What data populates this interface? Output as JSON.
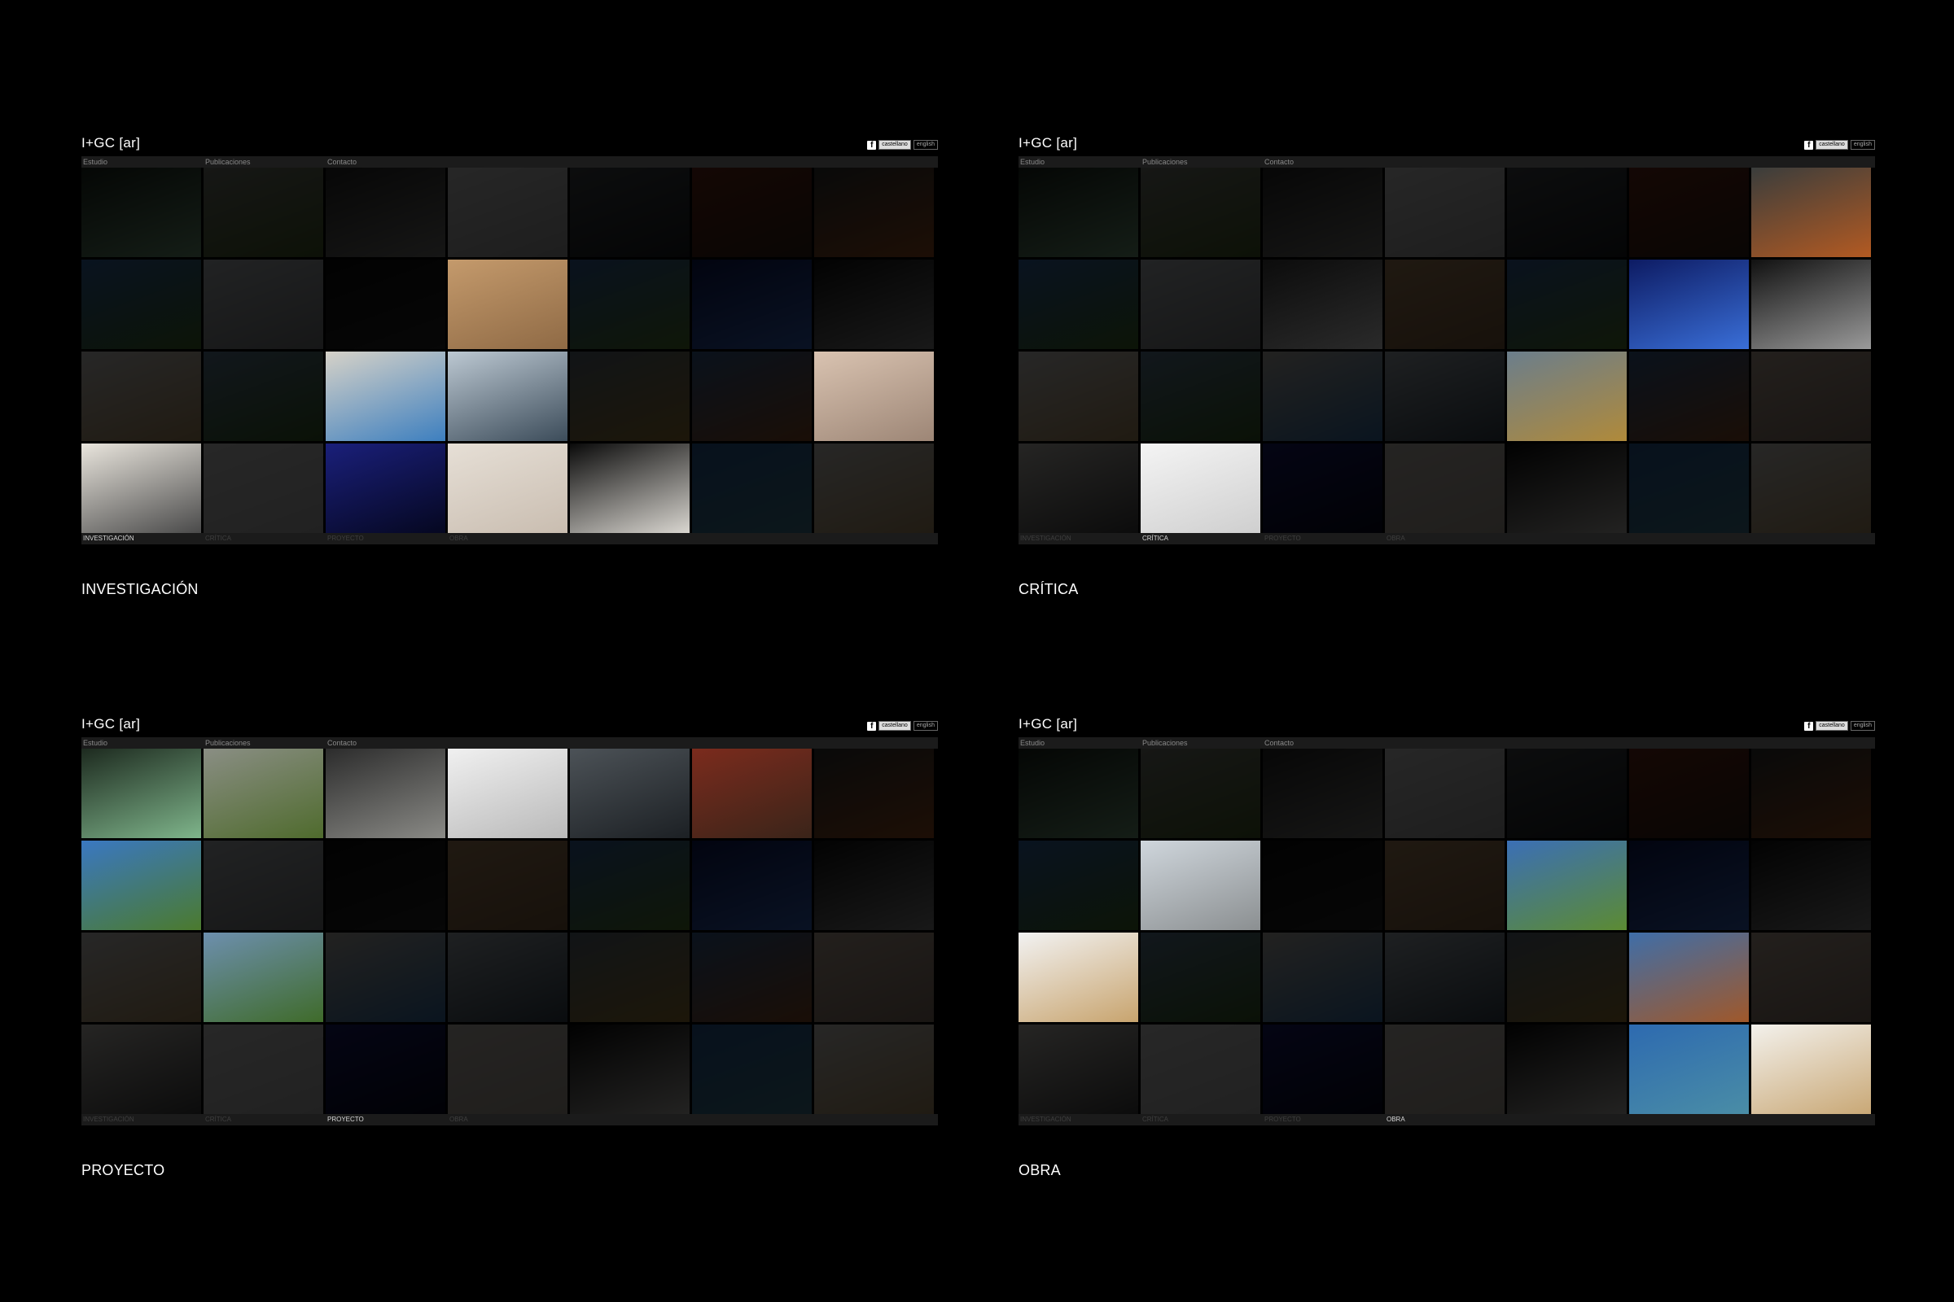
{
  "site": {
    "logo": "I+GC [ar]",
    "nav": [
      "Estudio",
      "Publicaciones",
      "Contacto"
    ],
    "categories": [
      "INVESTIGACIÓN",
      "CRÍTICA",
      "PROYECTO",
      "OBRA"
    ],
    "lang_buttons": [
      {
        "label": "castellano",
        "active": true
      },
      {
        "label": "english",
        "active": false
      }
    ]
  },
  "colors": {
    "background": "#000000",
    "bar": "#1b1b1b",
    "text": "#ffffff",
    "dim_text": "#3f3f3f"
  },
  "tiles": [
    {
      "id": "pattern-green",
      "top": "#1d2a1f",
      "bottom": "#7fb58b"
    },
    {
      "id": "house-lawn",
      "top": "#8a8e84",
      "bottom": "#4f6b2d"
    },
    {
      "id": "night-house",
      "top": "#2c2c2c",
      "bottom": "#8a8a86"
    },
    {
      "id": "wire-model",
      "top": "#f0f0f0",
      "bottom": "#b9b9b9"
    },
    {
      "id": "glass-atrium",
      "top": "#4c5257",
      "bottom": "#1c2024"
    },
    {
      "id": "red-canopy",
      "top": "#7b2b1d",
      "bottom": "#3a2419"
    },
    {
      "id": "robot-arm",
      "top": "#3a3d3c",
      "bottom": "#b35a22"
    },
    {
      "id": "park-towers",
      "top": "#3a78c2",
      "bottom": "#4b7a2d"
    },
    {
      "id": "white-facade",
      "top": "#cfd6dc",
      "bottom": "#8b8f91"
    },
    {
      "id": "hex-forms",
      "top": "#0c0c0c",
      "bottom": "#2a2a2a"
    },
    {
      "id": "wood-blocks",
      "top": "#c49a6c",
      "bottom": "#8f6a45"
    },
    {
      "id": "white-villa",
      "top": "#3b6fb6",
      "bottom": "#5c8b32"
    },
    {
      "id": "world-map",
      "top": "#0d1b63",
      "bottom": "#3a6fd8"
    },
    {
      "id": "bw-grid",
      "top": "#111111",
      "bottom": "#9a9a9a"
    },
    {
      "id": "portfolio",
      "top": "#f2f2f2",
      "bottom": "#c8a46e"
    },
    {
      "id": "tree-render",
      "top": "#6d8fae",
      "bottom": "#3f6b2a"
    },
    {
      "id": "color-panels",
      "top": "#d6d2c8",
      "bottom": "#3d7fbf"
    },
    {
      "id": "escalators",
      "top": "#bcc8d2",
      "bottom": "#3c4c5a"
    },
    {
      "id": "mesh-facade",
      "top": "#6b7e8c",
      "bottom": "#b08a3a"
    },
    {
      "id": "brick-wall",
      "top": "#3f6ea8",
      "bottom": "#a0582a"
    },
    {
      "id": "wax-hole",
      "top": "#d9c3b1",
      "bottom": "#9d8676"
    },
    {
      "id": "folded-model",
      "top": "#e9e5dd",
      "bottom": "#4a4a4a"
    },
    {
      "id": "section-sketch",
      "top": "#f4f4f4",
      "bottom": "#cfcfcf"
    },
    {
      "id": "blue-light",
      "top": "#1a1f7a",
      "bottom": "#050720"
    },
    {
      "id": "white-hand",
      "top": "#e6dfd6",
      "bottom": "#c9bdb0"
    },
    {
      "id": "white-blob",
      "top": "#0a0a0a",
      "bottom": "#d9d6d0"
    },
    {
      "id": "pool-house",
      "top": "#2d6ab0",
      "bottom": "#4a8da6"
    },
    {
      "id": "wood-tray",
      "top": "#f3f1ec",
      "bottom": "#c9a876"
    }
  ],
  "panels": [
    {
      "caption": "INVESTIGACIÓN",
      "footer": [
        "INVESTIGACIÓN",
        "CRÍTICA",
        "PROYECTO",
        "OBRA"
      ],
      "active": 0,
      "lit": [
        0,
        0,
        0,
        0,
        0,
        0,
        0,
        0,
        0,
        0,
        1,
        0,
        0,
        0,
        0,
        0,
        1,
        1,
        0,
        0,
        1,
        1,
        0,
        1,
        1,
        1,
        0,
        0
      ]
    },
    {
      "caption": "CRÍTICA",
      "footer": [
        "INVESTIGACIÓN",
        "CRÍTICA",
        "PROYECTO",
        "OBRA"
      ],
      "active": 1,
      "lit": [
        0,
        0,
        0,
        0,
        0,
        0,
        1,
        0,
        0,
        1,
        0,
        0,
        1,
        1,
        0,
        0,
        0,
        0,
        1,
        0,
        0,
        0,
        1,
        0,
        0,
        0,
        0,
        0
      ]
    },
    {
      "caption": "PROYECTO",
      "footer": [
        "INVESTIGACIÓN",
        "CRÍTICA",
        "PROYECTO",
        "OBRA"
      ],
      "active": 2,
      "lit": [
        1,
        1,
        1,
        1,
        1,
        1,
        0,
        1,
        0,
        0,
        0,
        0,
        0,
        0,
        0,
        1,
        0,
        0,
        0,
        0,
        0,
        0,
        0,
        0,
        0,
        0,
        0,
        0
      ]
    },
    {
      "caption": "OBRA",
      "footer": [
        "INVESTIGACIÓN",
        "CRÍTICA",
        "PROYECTO",
        "OBRA"
      ],
      "active": 3,
      "lit": [
        0,
        0,
        0,
        0,
        0,
        0,
        0,
        0,
        1,
        0,
        0,
        1,
        0,
        0,
        1,
        0,
        0,
        0,
        0,
        1,
        0,
        0,
        0,
        0,
        0,
        0,
        1,
        1
      ]
    }
  ]
}
